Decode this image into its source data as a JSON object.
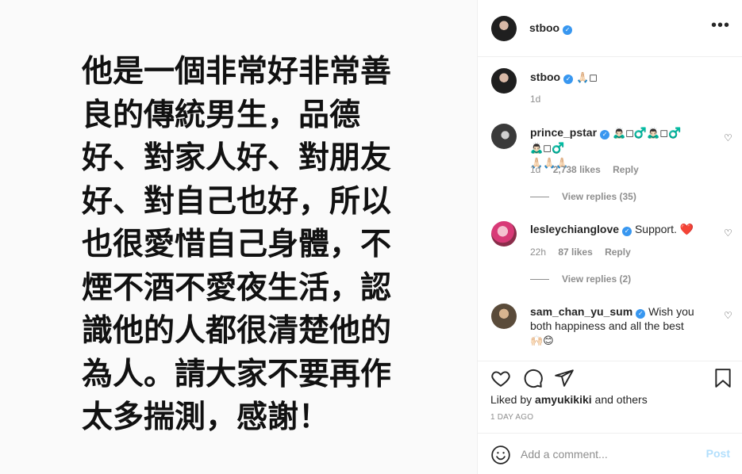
{
  "post": {
    "lines": [
      "他是一個非常好非常善",
      "良的傳統男生，品德",
      "好、對家人好、對朋友",
      "好、對自己也好，所以",
      "也很愛惜自己身體，不",
      "煙不酒不愛夜生活，認",
      "識他的人都很清楚他的",
      "為人。請大家不要再作",
      "太多揣測，感謝！"
    ]
  },
  "header": {
    "username": "stboo",
    "more": "•••"
  },
  "caption": {
    "username": "stboo",
    "text": "🙏🏻◻",
    "time": "1d"
  },
  "comments": [
    {
      "username": "prince_pstar",
      "line1": "🙇🏻‍♂️◻♂️🙇🏻‍♂️◻♂️🙇🏻‍♂️◻♂️",
      "line2": "🙏🏻🙏🏻🙏🏻",
      "time": "1d",
      "likes": "2,738 likes",
      "reply": "Reply",
      "view_replies": "View replies (35)"
    },
    {
      "username": "lesleychianglove",
      "line1": "Support. ❤️",
      "time": "22h",
      "likes": "87 likes",
      "reply": "Reply",
      "view_replies": "View replies (2)"
    },
    {
      "username": "sam_chan_yu_sum",
      "line1": "Wish you",
      "line2": "both happiness and all the best",
      "line3": "🙌🏻😊"
    }
  ],
  "actions": {
    "liked_by_prefix": "Liked by ",
    "liked_by_user": "amyukikiki",
    "liked_by_suffix": " and others",
    "time": "1 DAY AGO"
  },
  "add_comment": {
    "placeholder": "Add a comment...",
    "post_label": "Post"
  },
  "colors": {
    "verified": "#3897f0",
    "post_button": "#b2dffc",
    "heart": "#ed4956"
  }
}
